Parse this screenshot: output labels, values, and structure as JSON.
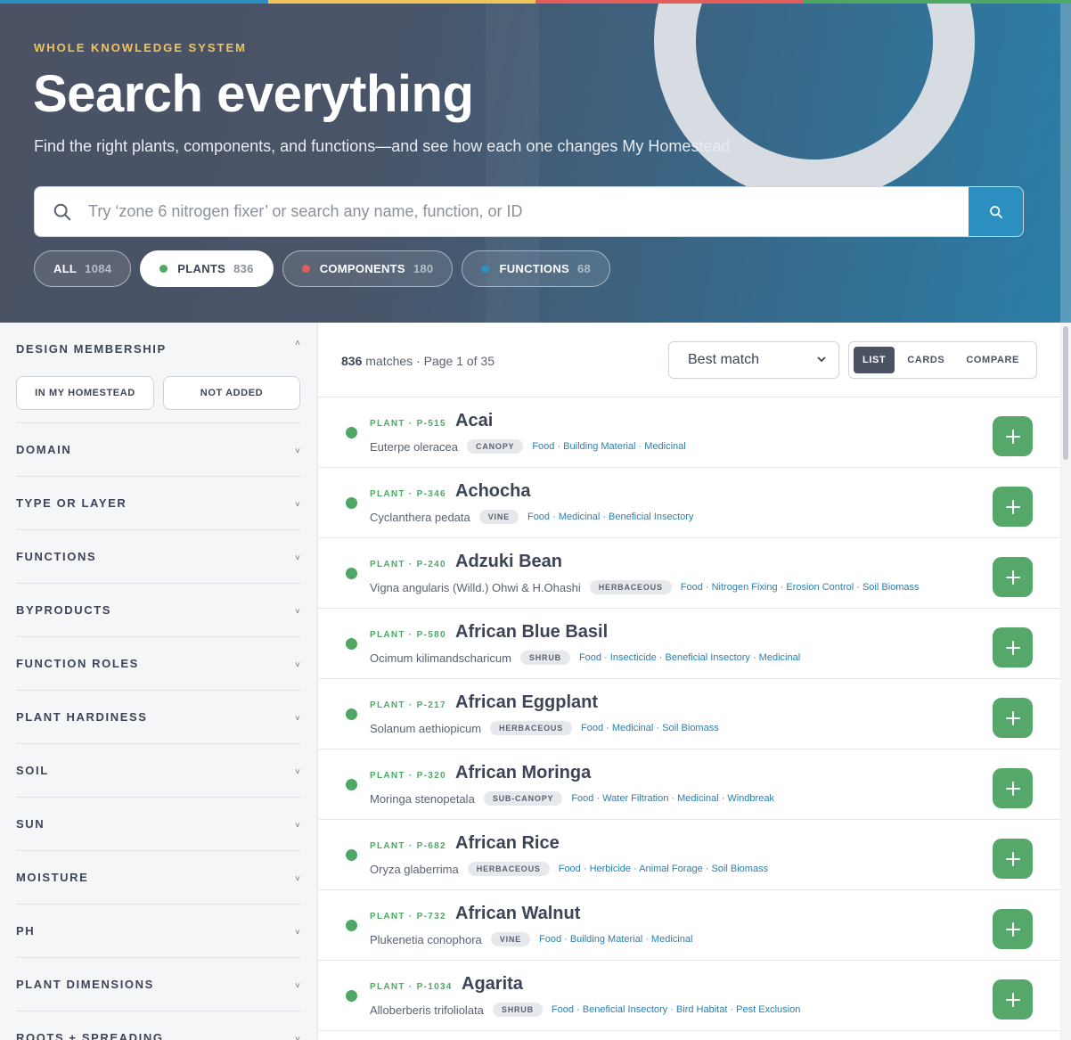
{
  "stripe_colors": [
    "#2f8fc0",
    "#f1c45a",
    "#e35d5d",
    "#4fa766"
  ],
  "hero": {
    "eyebrow": "WHOLE KNOWLEDGE SYSTEM",
    "title": "Search everything",
    "subtitle": "Find the right plants, components, and functions—and see how each one changes My Homestead"
  },
  "search": {
    "placeholder": "Try ‘zone 6 nitrogen fixer’ or search any name, function, or ID",
    "value": ""
  },
  "pills": [
    {
      "label": "ALL",
      "count": "1084",
      "dot": "",
      "active": false
    },
    {
      "label": "PLANTS",
      "count": "836",
      "dot": "#4fa766",
      "active": true
    },
    {
      "label": "COMPONENTS",
      "count": "180",
      "dot": "#e35d5d",
      "active": false
    },
    {
      "label": "FUNCTIONS",
      "count": "68",
      "dot": "#2f8fc0",
      "active": false
    }
  ],
  "sidebar": {
    "membership": {
      "label": "DESIGN MEMBERSHIP",
      "buttons": [
        "IN MY HOMESTEAD",
        "NOT ADDED"
      ]
    },
    "facets": [
      "DOMAIN",
      "TYPE OR LAYER",
      "FUNCTIONS",
      "BYPRODUCTS",
      "FUNCTION ROLES",
      "PLANT HARDINESS",
      "SOIL",
      "SUN",
      "MOISTURE",
      "PH",
      "PLANT DIMENSIONS",
      "ROOTS + SPREADING"
    ]
  },
  "results": {
    "summary_count": "836",
    "summary_rest": "matches · Page 1 of 35",
    "sort": "Best match",
    "views": [
      "LIST",
      "CARDS",
      "COMPARE"
    ],
    "active_view": "LIST",
    "items": [
      {
        "kind": "PLANT · P-515",
        "name": "Acai",
        "sci": "Euterpe oleracea",
        "layer": "CANOPY",
        "functions": "Food · Building Material · Medicinal"
      },
      {
        "kind": "PLANT · P-346",
        "name": "Achocha",
        "sci": "Cyclanthera pedata",
        "layer": "VINE",
        "functions": "Food · Medicinal · Beneficial Insectory"
      },
      {
        "kind": "PLANT · P-240",
        "name": "Adzuki Bean",
        "sci": "Vigna angularis (Willd.) Ohwi & H.Ohashi",
        "layer": "HERBACEOUS",
        "functions": "Food · Nitrogen Fixing · Erosion Control · Soil Biomass"
      },
      {
        "kind": "PLANT · P-580",
        "name": "African Blue Basil",
        "sci": "Ocimum kilimandscharicum",
        "layer": "SHRUB",
        "functions": "Food · Insecticide · Beneficial Insectory · Medicinal"
      },
      {
        "kind": "PLANT · P-217",
        "name": "African Eggplant",
        "sci": "Solanum aethiopicum",
        "layer": "HERBACEOUS",
        "functions": "Food · Medicinal · Soil Biomass"
      },
      {
        "kind": "PLANT · P-320",
        "name": "African Moringa",
        "sci": "Moringa stenopetala",
        "layer": "SUB-CANOPY",
        "functions": "Food · Water Filtration · Medicinal · Windbreak"
      },
      {
        "kind": "PLANT · P-682",
        "name": "African Rice",
        "sci": "Oryza glaberrima",
        "layer": "HERBACEOUS",
        "functions": "Food · Herbicide · Animal Forage · Soil Biomass"
      },
      {
        "kind": "PLANT · P-732",
        "name": "African Walnut",
        "sci": "Plukenetia conophora",
        "layer": "VINE",
        "functions": "Food · Building Material · Medicinal"
      },
      {
        "kind": "PLANT · P-1034",
        "name": "Agarita",
        "sci": "Alloberberis trifoliolata",
        "layer": "SHRUB",
        "functions": "Food · Beneficial Insectory · Bird Habitat · Pest Exclusion"
      }
    ]
  },
  "icons": {
    "search": "search-icon",
    "add": "plus-icon",
    "chevron": "chevron-down-icon",
    "collapse": "chevron-up-icon"
  }
}
